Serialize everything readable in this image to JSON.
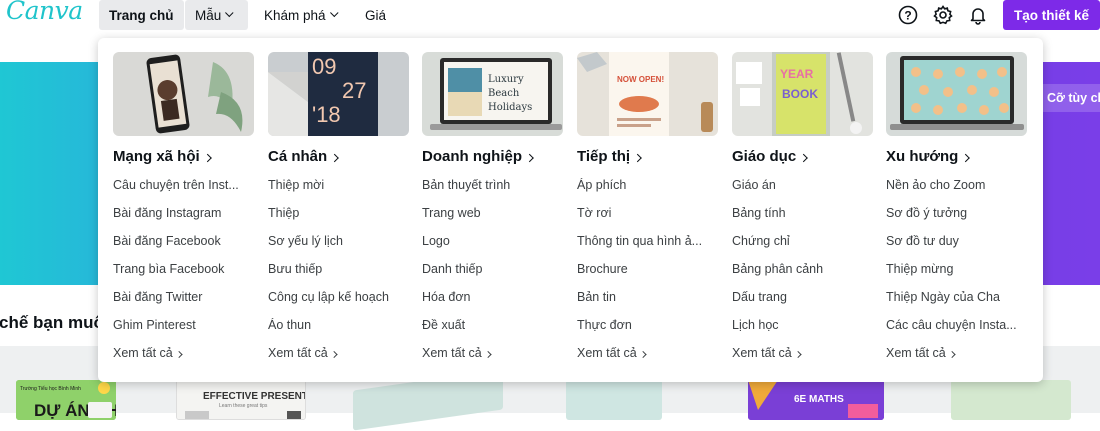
{
  "logo": "Canva",
  "nav": {
    "home": "Trang chủ",
    "templates": "Mẫu",
    "discover": "Khám phá",
    "pricing": "Giá"
  },
  "header_icons": [
    "help-icon",
    "gear-icon",
    "bell-icon"
  ],
  "cta_label": "Tạo thiết kế",
  "hero_button": "Cỡ tùy ch",
  "section_title": "chế bạn muốn",
  "colors": {
    "brand_purple": "#7d2ae8",
    "logo_teal": "#20c4cb",
    "hero_start": "#1fc7d4",
    "hero_end": "#7a3ee8"
  },
  "menu": {
    "see_all": "Xem tất cả",
    "columns": [
      {
        "title": "Mạng xã hội",
        "items": [
          "Câu chuyện trên Inst...",
          "Bài đăng Instagram",
          "Bài đăng Facebook",
          "Trang bìa Facebook",
          "Bài đăng Twitter",
          "Ghim Pinterest"
        ],
        "thumb": {
          "kind": "phone",
          "bg": "#d9d9d6"
        }
      },
      {
        "title": "Cá nhân",
        "items": [
          "Thiệp mời",
          "Thiệp",
          "Sơ yếu lý lịch",
          "Bưu thiếp",
          "Công cụ lập kế hoạch",
          "Áo thun"
        ],
        "thumb": {
          "kind": "card",
          "bg": "#c9cdd0",
          "text_top": "09",
          "text_top2": "27",
          "text_bottom": "'18"
        }
      },
      {
        "title": "Doanh nghiệp",
        "items": [
          "Bản thuyết trình",
          "Trang web",
          "Logo",
          "Danh thiếp",
          "Hóa đơn",
          "Đề xuất"
        ],
        "thumb": {
          "kind": "laptop",
          "bg": "#d8dcd8",
          "headline": "Luxury Beach Holidays"
        }
      },
      {
        "title": "Tiếp thị",
        "items": [
          "Áp phích",
          "Tờ rơi",
          "Thông tin qua hình ả...",
          "Brochure",
          "Bản tin",
          "Thực đơn"
        ],
        "thumb": {
          "kind": "poster",
          "bg": "#e6e2da",
          "headline": "NOW OPEN!"
        }
      },
      {
        "title": "Giáo dục",
        "items": [
          "Giáo án",
          "Bảng tính",
          "Chứng chỉ",
          "Bảng phân cảnh",
          "Dấu trang",
          "Lịch học"
        ],
        "thumb": {
          "kind": "yearbook",
          "bg": "#e2e3df",
          "headline": "YEARBOOK"
        }
      },
      {
        "title": "Xu hướng",
        "items": [
          "Nền ảo cho Zoom",
          "Sơ đồ ý tưởng",
          "Sơ đồ tư duy",
          "Thiệp mừng",
          "Thiệp Ngày của Cha",
          "Các câu chuyện Insta..."
        ],
        "thumb": {
          "kind": "zoom",
          "bg": "#d6dbd9"
        }
      }
    ]
  },
  "thumbnails_row": [
    {
      "label": "DỰ ÁN NHÓM",
      "bg": "#8fd16a"
    },
    {
      "label": "EFFECTIVE PRESENTING",
      "bg": "#f4f4f2"
    },
    {
      "label": "",
      "bg": "#cfe3de"
    },
    {
      "label": "",
      "bg": "#cfe6e2"
    },
    {
      "label": "6E MATHS",
      "bg": "#7a3fd6"
    },
    {
      "label": "",
      "bg": "#d4e8cf"
    }
  ]
}
